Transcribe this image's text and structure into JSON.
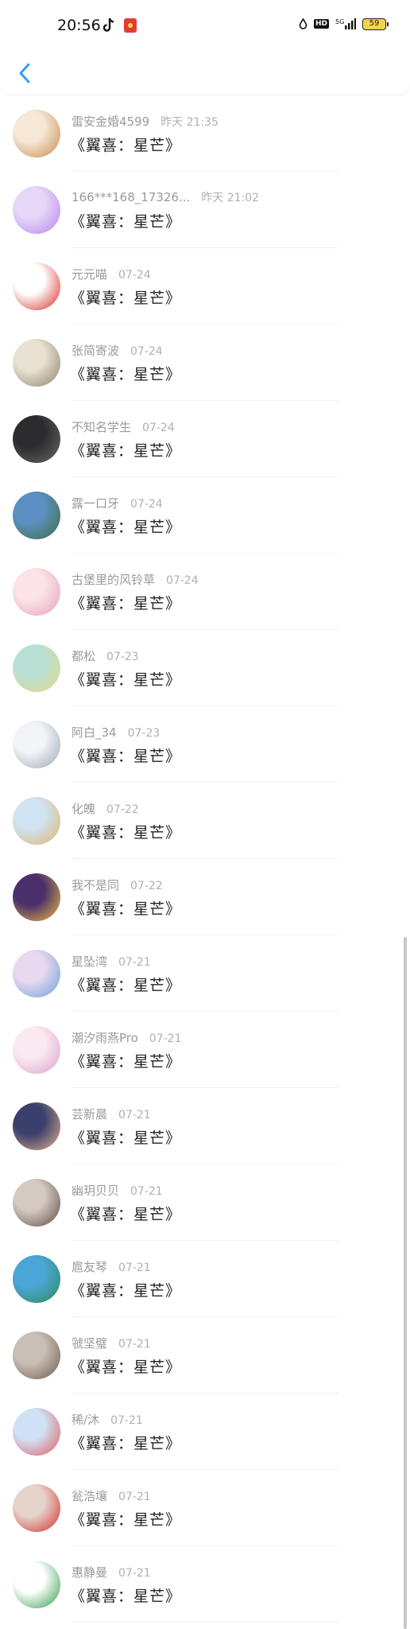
{
  "status_bar": {
    "time": "20:56",
    "network": "5G",
    "hd": "HD",
    "battery": "59"
  },
  "header": {
    "back_icon": "chevron-left-icon",
    "accent": "#2f9df4"
  },
  "items": [
    {
      "name": "雷安金婚4599",
      "time": "昨天 21:35",
      "message": "《翼喜：星芒》",
      "colors": [
        "#f6e7d6",
        "#c58a4a"
      ]
    },
    {
      "name": "166***168_17326...",
      "time": "昨天 21:02",
      "message": "《翼喜：星芒》",
      "colors": [
        "#e6d7f7",
        "#b784f0"
      ]
    },
    {
      "name": "元元喵",
      "time": "07-24",
      "message": "《翼喜：星芒》",
      "colors": [
        "#ffffff",
        "#d8261d"
      ]
    },
    {
      "name": "张简寄波",
      "time": "07-24",
      "message": "《翼喜：星芒》",
      "colors": [
        "#e7e2d2",
        "#8c7f6a"
      ]
    },
    {
      "name": "不知名学生",
      "time": "07-24",
      "message": "《翼喜：星芒》",
      "colors": [
        "#2c2c2e",
        "#6b6b70"
      ]
    },
    {
      "name": "露一口牙",
      "time": "07-24",
      "message": "《翼喜：星芒》",
      "colors": [
        "#5c8fc2",
        "#3f6d3a"
      ]
    },
    {
      "name": "古堡里的风铃草",
      "time": "07-24",
      "message": "《翼喜：星芒》",
      "colors": [
        "#fbe3e8",
        "#e8a0b3"
      ]
    },
    {
      "name": "都松",
      "time": "07-23",
      "message": "《翼喜：星芒》",
      "colors": [
        "#b8e0d4",
        "#e3d98a"
      ]
    },
    {
      "name": "阿白_34",
      "time": "07-23",
      "message": "《翼喜：星芒》",
      "colors": [
        "#f2f4f7",
        "#9aa6b8"
      ]
    },
    {
      "name": "化魄",
      "time": "07-22",
      "message": "《翼喜：星芒》",
      "colors": [
        "#cfe3f2",
        "#e0b36e"
      ]
    },
    {
      "name": "我不是同",
      "time": "07-22",
      "message": "《翼喜：星芒》",
      "colors": [
        "#4a2f6b",
        "#f0c040"
      ]
    },
    {
      "name": "星坠湾",
      "time": "07-21",
      "message": "《翼喜：星芒》",
      "colors": [
        "#e8d8f0",
        "#6aa2d8"
      ]
    },
    {
      "name": "潮汐雨燕Pro",
      "time": "07-21",
      "message": "《翼喜：星芒》",
      "colors": [
        "#fbe9f2",
        "#d9a3c8"
      ]
    },
    {
      "name": "芸新晨",
      "time": "07-21",
      "message": "《翼喜：星芒》",
      "colors": [
        "#3a3f6b",
        "#e6b48a"
      ]
    },
    {
      "name": "幽玥贝贝",
      "time": "07-21",
      "message": "《翼喜：星芒》",
      "colors": [
        "#d6c9c2",
        "#5a4a44"
      ]
    },
    {
      "name": "扈友琴",
      "time": "07-21",
      "message": "《翼喜：星芒》",
      "colors": [
        "#4aa6d6",
        "#2f8a5a"
      ]
    },
    {
      "name": "虢坚璧",
      "time": "07-21",
      "message": "《翼喜：星芒》",
      "colors": [
        "#c9bfb6",
        "#6d5b50"
      ]
    },
    {
      "name": "稀/沐",
      "time": "07-21",
      "message": "《翼喜：星芒》",
      "colors": [
        "#cfe2f5",
        "#e25a5a"
      ]
    },
    {
      "name": "瓮浩壤",
      "time": "07-21",
      "message": "《翼喜：星芒》",
      "colors": [
        "#e6d4cb",
        "#d22b2b"
      ]
    },
    {
      "name": "惠静曼",
      "time": "07-21",
      "message": "《翼喜：星芒》",
      "colors": [
        "#ffffff",
        "#2e9d48"
      ]
    }
  ]
}
